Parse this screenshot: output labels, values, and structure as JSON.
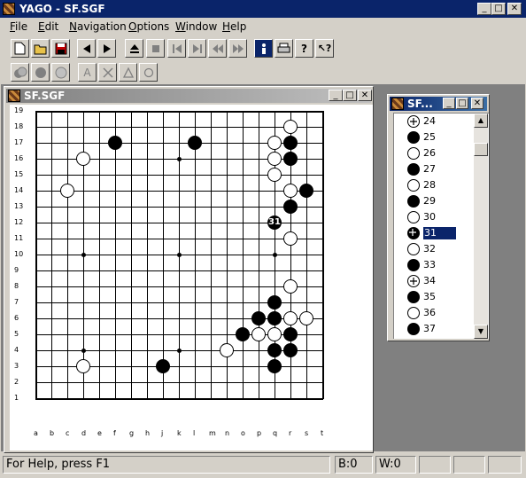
{
  "window": {
    "title": "YAGO - SF.SGF"
  },
  "menu": {
    "items": [
      {
        "label": "File",
        "ul": "F",
        "rest": "ile"
      },
      {
        "label": "Edit",
        "ul": "E",
        "rest": "dit"
      },
      {
        "label": "Navigation",
        "ul": "N",
        "rest": "avigation"
      },
      {
        "label": "Options",
        "ul": "O",
        "rest": "ptions"
      },
      {
        "label": "Window",
        "ul": "W",
        "rest": "indow"
      },
      {
        "label": "Help",
        "ul": "H",
        "rest": "elp"
      }
    ]
  },
  "toolbar": {
    "buttons": [
      "new-file",
      "open-folder",
      "save",
      "back",
      "forward",
      "eject",
      "stop",
      "first",
      "last",
      "prev-variation",
      "next-variation",
      "info",
      "print",
      "help",
      "context-help"
    ]
  },
  "toolbar2": {
    "buttons": [
      "stone-pair",
      "black-stone",
      "white-stone",
      "label-a",
      "mark-x",
      "mark-triangle",
      "mark-circle"
    ],
    "label_a": "A"
  },
  "board_window": {
    "title": "SF.SGF"
  },
  "board": {
    "size": 19,
    "col_labels": [
      "a",
      "b",
      "c",
      "d",
      "e",
      "f",
      "g",
      "h",
      "j",
      "k",
      "l",
      "m",
      "n",
      "o",
      "p",
      "q",
      "r",
      "s",
      "t"
    ],
    "row_labels": [
      "19",
      "18",
      "17",
      "16",
      "15",
      "14",
      "13",
      "12",
      "11",
      "10",
      "9",
      "8",
      "7",
      "6",
      "5",
      "4",
      "3",
      "2",
      "1"
    ],
    "hoshi": [
      [
        "d",
        4
      ],
      [
        "k",
        4
      ],
      [
        "q",
        4
      ],
      [
        "d",
        10
      ],
      [
        "k",
        10
      ],
      [
        "q",
        10
      ],
      [
        "d",
        16
      ],
      [
        "k",
        16
      ],
      [
        "q",
        16
      ]
    ],
    "stones": [
      {
        "col": "r",
        "row": 18,
        "color": "white"
      },
      {
        "col": "f",
        "row": 17,
        "color": "black"
      },
      {
        "col": "l",
        "row": 17,
        "color": "black"
      },
      {
        "col": "q",
        "row": 17,
        "color": "white"
      },
      {
        "col": "r",
        "row": 17,
        "color": "black"
      },
      {
        "col": "d",
        "row": 16,
        "color": "white"
      },
      {
        "col": "q",
        "row": 16,
        "color": "white"
      },
      {
        "col": "r",
        "row": 16,
        "color": "black"
      },
      {
        "col": "q",
        "row": 15,
        "color": "white"
      },
      {
        "col": "c",
        "row": 14,
        "color": "white"
      },
      {
        "col": "r",
        "row": 14,
        "color": "white"
      },
      {
        "col": "s",
        "row": 14,
        "color": "black"
      },
      {
        "col": "r",
        "row": 13,
        "color": "black"
      },
      {
        "col": "q",
        "row": 12,
        "color": "black",
        "label": "31"
      },
      {
        "col": "r",
        "row": 11,
        "color": "white"
      },
      {
        "col": "r",
        "row": 8,
        "color": "white"
      },
      {
        "col": "q",
        "row": 7,
        "color": "black"
      },
      {
        "col": "p",
        "row": 6,
        "color": "black"
      },
      {
        "col": "q",
        "row": 6,
        "color": "black"
      },
      {
        "col": "r",
        "row": 6,
        "color": "white"
      },
      {
        "col": "s",
        "row": 6,
        "color": "white"
      },
      {
        "col": "o",
        "row": 5,
        "color": "black"
      },
      {
        "col": "p",
        "row": 5,
        "color": "white"
      },
      {
        "col": "q",
        "row": 5,
        "color": "white"
      },
      {
        "col": "r",
        "row": 5,
        "color": "black"
      },
      {
        "col": "n",
        "row": 4,
        "color": "white"
      },
      {
        "col": "q",
        "row": 4,
        "color": "black"
      },
      {
        "col": "r",
        "row": 4,
        "color": "black"
      },
      {
        "col": "d",
        "row": 3,
        "color": "white"
      },
      {
        "col": "j",
        "row": 3,
        "color": "black"
      },
      {
        "col": "q",
        "row": 3,
        "color": "black"
      }
    ]
  },
  "move_list_window": {
    "title": "SF..."
  },
  "move_list": {
    "selected": "31",
    "items": [
      {
        "num": "24",
        "color": "white",
        "marked": true
      },
      {
        "num": "25",
        "color": "black"
      },
      {
        "num": "26",
        "color": "white"
      },
      {
        "num": "27",
        "color": "black"
      },
      {
        "num": "28",
        "color": "white"
      },
      {
        "num": "29",
        "color": "black"
      },
      {
        "num": "30",
        "color": "white"
      },
      {
        "num": "31",
        "color": "black",
        "marked": true
      },
      {
        "num": "32",
        "color": "white"
      },
      {
        "num": "33",
        "color": "black"
      },
      {
        "num": "34",
        "color": "white",
        "marked": true
      },
      {
        "num": "35",
        "color": "black"
      },
      {
        "num": "36",
        "color": "white"
      },
      {
        "num": "37",
        "color": "black"
      }
    ]
  },
  "status": {
    "help_text": "For Help, press F1",
    "black_captures": "B:0",
    "white_captures": "W:0"
  },
  "colors": {
    "title_active": "#0a246a",
    "title_inactive": "#808080",
    "face": "#d4d0c8",
    "mdi_bg": "#808080"
  }
}
